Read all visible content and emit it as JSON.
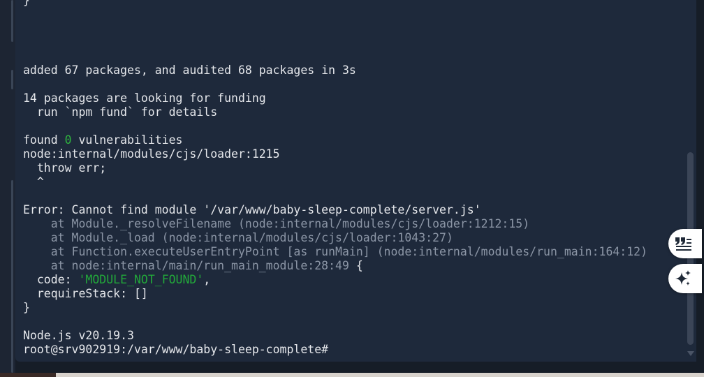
{
  "terminal": {
    "lines": [
      {
        "text": "}"
      },
      {
        "text": ""
      },
      {
        "text": ""
      },
      {
        "text": ""
      },
      {
        "text": ""
      },
      {
        "text": "added 67 packages, and audited 68 packages in 3s"
      },
      {
        "text": ""
      },
      {
        "text": "14 packages are looking for funding"
      },
      {
        "text": "  run `npm fund` for details"
      },
      {
        "text": ""
      },
      {
        "parts": [
          "found ",
          "0",
          " vulnerabilities"
        ]
      },
      {
        "text": "node:internal/modules/cjs/loader:1215"
      },
      {
        "text": "  throw err;"
      },
      {
        "text": "  ^"
      },
      {
        "text": ""
      },
      {
        "text": "Error: Cannot find module '/var/www/baby-sleep-complete/server.js'"
      },
      {
        "text": "    at Module._resolveFilename (node:internal/modules/cjs/loader:1212:15)"
      },
      {
        "text": "    at Module._load (node:internal/modules/cjs/loader:1043:27)"
      },
      {
        "text": "    at Function.executeUserEntryPoint [as runMain] (node:internal/modules/run_main:164:12)"
      },
      {
        "parts": [
          "    at node:internal/main/run_main_module:28:49",
          " {"
        ]
      },
      {
        "parts": [
          "  code: ",
          "'MODULE_NOT_FOUND'",
          ","
        ]
      },
      {
        "text": "  requireStack: []"
      },
      {
        "text": "}"
      },
      {
        "text": ""
      },
      {
        "text": "Node.js v20.19.3"
      },
      {
        "text": "root@srv902919:/var/www/baby-sleep-complete#"
      }
    ]
  },
  "icons": {
    "reader": "reader-mode-icon",
    "ai": "ai-sparkle-icon"
  },
  "colors": {
    "background": "#1e293b",
    "text": "#e5e7eb",
    "dim_text": "#8b95a5",
    "green": "#2fb33f"
  }
}
